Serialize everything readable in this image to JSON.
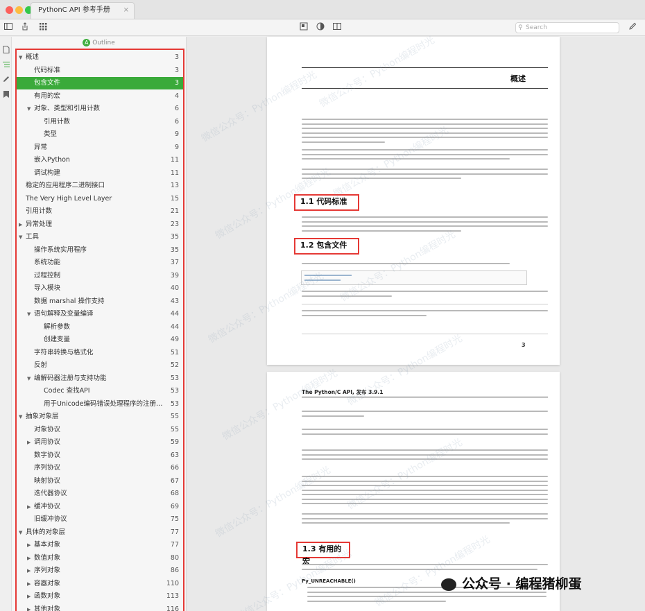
{
  "window": {
    "tab_title": "PythonC API 参考手册",
    "tab_close": "×",
    "traffic_colors": [
      "#fc605c",
      "#fdbc40",
      "#34c84a"
    ]
  },
  "toolbar": {
    "search_placeholder": "Search"
  },
  "outline": {
    "header_badge": "A",
    "header_label": "Outline",
    "items": [
      {
        "label": "概述",
        "page": "3",
        "level": 0,
        "tri": "down"
      },
      {
        "label": "代码标准",
        "page": "3",
        "level": 1,
        "tri": ""
      },
      {
        "label": "包含文件",
        "page": "3",
        "level": 1,
        "tri": "",
        "selected": true
      },
      {
        "label": "有用的宏",
        "page": "4",
        "level": 1,
        "tri": ""
      },
      {
        "label": "对象、类型和引用计数",
        "page": "6",
        "level": 1,
        "tri": "down"
      },
      {
        "label": "引用计数",
        "page": "6",
        "level": 2,
        "tri": ""
      },
      {
        "label": "类型",
        "page": "9",
        "level": 2,
        "tri": ""
      },
      {
        "label": "异常",
        "page": "9",
        "level": 1,
        "tri": ""
      },
      {
        "label": "嵌入Python",
        "page": "11",
        "level": 1,
        "tri": ""
      },
      {
        "label": "调试构建",
        "page": "11",
        "level": 1,
        "tri": ""
      },
      {
        "label": "稳定的应用程序二进制接口",
        "page": "13",
        "level": 0,
        "tri": ""
      },
      {
        "label": "The Very High Level Layer",
        "page": "15",
        "level": 0,
        "tri": ""
      },
      {
        "label": "引用计数",
        "page": "21",
        "level": 0,
        "tri": ""
      },
      {
        "label": "异常处理",
        "page": "23",
        "level": 0,
        "tri": "right"
      },
      {
        "label": "工具",
        "page": "35",
        "level": 0,
        "tri": "down"
      },
      {
        "label": "操作系统实用程序",
        "page": "35",
        "level": 1,
        "tri": ""
      },
      {
        "label": "系统功能",
        "page": "37",
        "level": 1,
        "tri": ""
      },
      {
        "label": "过程控制",
        "page": "39",
        "level": 1,
        "tri": ""
      },
      {
        "label": "导入模块",
        "page": "40",
        "level": 1,
        "tri": ""
      },
      {
        "label": "数据 marshal 操作支持",
        "page": "43",
        "level": 1,
        "tri": ""
      },
      {
        "label": "语句解释及变量编译",
        "page": "44",
        "level": 1,
        "tri": "down"
      },
      {
        "label": "解析参数",
        "page": "44",
        "level": 2,
        "tri": ""
      },
      {
        "label": "创建变量",
        "page": "49",
        "level": 2,
        "tri": ""
      },
      {
        "label": "字符串转换与格式化",
        "page": "51",
        "level": 1,
        "tri": ""
      },
      {
        "label": "反射",
        "page": "52",
        "level": 1,
        "tri": ""
      },
      {
        "label": "编解码器注册与支持功能",
        "page": "53",
        "level": 1,
        "tri": "down"
      },
      {
        "label": "Codec 查找API",
        "page": "53",
        "level": 2,
        "tri": ""
      },
      {
        "label": "用于Unicode编码错误处理程序的注册…",
        "page": "53",
        "level": 2,
        "tri": ""
      },
      {
        "label": "抽象对象层",
        "page": "55",
        "level": 0,
        "tri": "down"
      },
      {
        "label": "对象协议",
        "page": "55",
        "level": 1,
        "tri": ""
      },
      {
        "label": "调用协议",
        "page": "59",
        "level": 1,
        "tri": "right"
      },
      {
        "label": "数字协议",
        "page": "63",
        "level": 1,
        "tri": ""
      },
      {
        "label": "序列协议",
        "page": "66",
        "level": 1,
        "tri": ""
      },
      {
        "label": "映射协议",
        "page": "67",
        "level": 1,
        "tri": ""
      },
      {
        "label": "迭代器协议",
        "page": "68",
        "level": 1,
        "tri": ""
      },
      {
        "label": "缓冲协议",
        "page": "69",
        "level": 1,
        "tri": "right"
      },
      {
        "label": "旧缓冲协议",
        "page": "75",
        "level": 1,
        "tri": ""
      },
      {
        "label": "具体的对象层",
        "page": "77",
        "level": 0,
        "tri": "down"
      },
      {
        "label": "基本对象",
        "page": "77",
        "level": 1,
        "tri": "right"
      },
      {
        "label": "数值对象",
        "page": "80",
        "level": 1,
        "tri": "right"
      },
      {
        "label": "序列对象",
        "page": "86",
        "level": 1,
        "tri": "right"
      },
      {
        "label": "容器对象",
        "page": "110",
        "level": 1,
        "tri": "right"
      },
      {
        "label": "函数对象",
        "page": "113",
        "level": 1,
        "tri": "right"
      },
      {
        "label": "其他对象",
        "page": "116",
        "level": 1,
        "tri": "right"
      }
    ]
  },
  "document": {
    "page1": {
      "title": "概述",
      "sections": [
        "1.1 代码标准",
        "1.2 包含文件"
      ],
      "page_number": "3"
    },
    "page2": {
      "header": "The Python/C API, 发布 3.9.1",
      "label_ub": "Py_UNREACHABLE()",
      "section": "1.3 有用的宏"
    }
  },
  "footer": {
    "brand": "公众号 · 编程猪柳蛋"
  },
  "watermark": "微信公众号：Python编程时光"
}
